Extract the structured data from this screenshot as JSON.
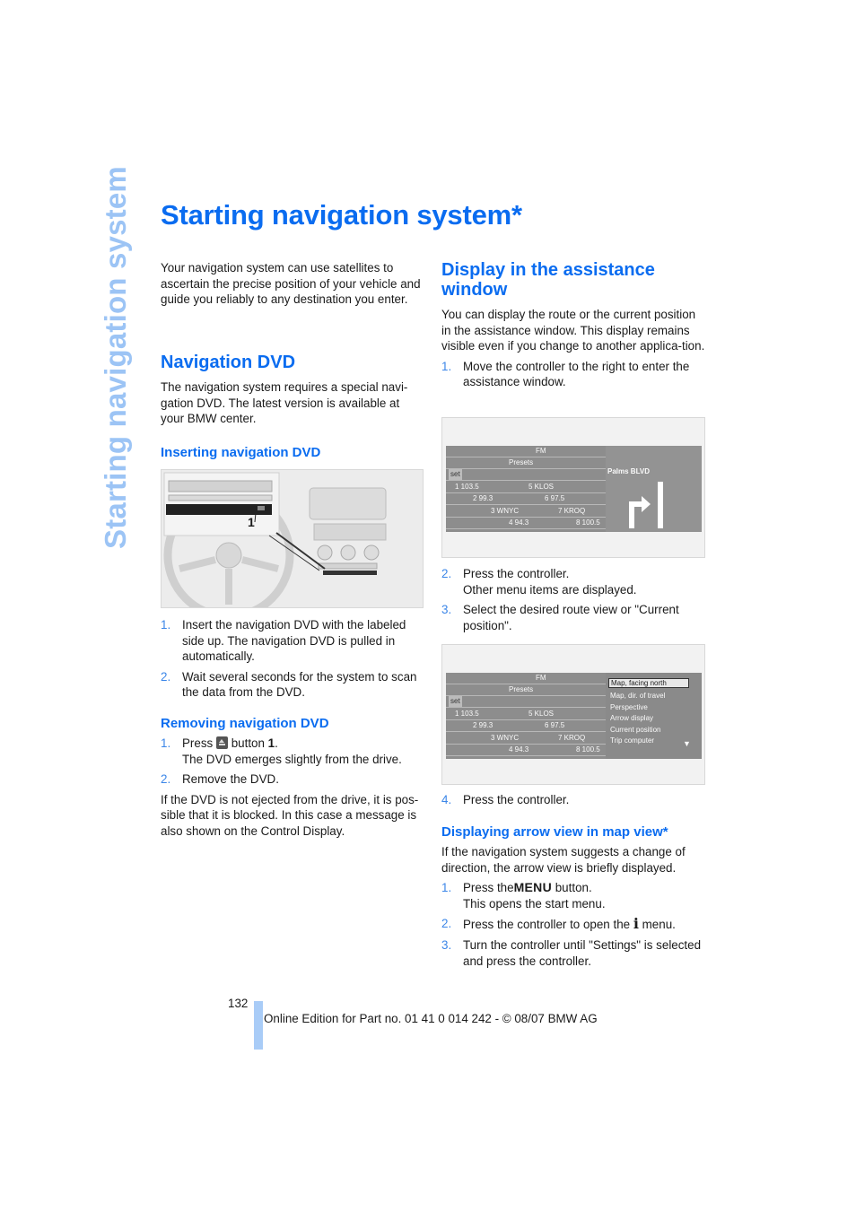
{
  "sidebar": {
    "title": "Starting navigation system"
  },
  "page": {
    "title": "Starting navigation system*"
  },
  "left": {
    "intro": "Your navigation system can use satellites to ascertain the precise position of your vehicle and guide you reliably to any destination you enter.",
    "nav_dvd": {
      "heading": "Navigation DVD",
      "text": "The navigation system requires a special navi-gation DVD. The latest version is available at your BMW center."
    },
    "inserting": {
      "heading": "Inserting navigation DVD",
      "figure_callout": "1",
      "steps": [
        {
          "num": "1.",
          "text": "Insert the navigation DVD with the labeled side up. The navigation DVD is pulled in automatically."
        },
        {
          "num": "2.",
          "text": "Wait several seconds for the system to scan the data from the DVD."
        }
      ]
    },
    "removing": {
      "heading": "Removing navigation DVD",
      "step1_num": "1.",
      "step1_pre": "Press",
      "step1_post": "button",
      "step1_ref": "1",
      "step1_dot": ".",
      "step1_line2": "The DVD emerges slightly from the drive.",
      "step2_num": "2.",
      "step2_text": "Remove the DVD.",
      "note": "If the DVD is not ejected from the drive, it is pos-sible that it is blocked. In this case a message is also shown on the Control Display."
    }
  },
  "right": {
    "assist": {
      "heading": "Display in the assistance window",
      "text": "You can display the route or the current position in the assistance window. This display remains visible even if you change to another applica-tion.",
      "step1": {
        "num": "1.",
        "text": "Move the controller to the right to enter the assistance window."
      },
      "step2": {
        "num": "2.",
        "text": "Press the controller.",
        "line2": "Other menu items are displayed."
      },
      "step3": {
        "num": "3.",
        "text": "Select the desired route view or \"Current position\"."
      },
      "step4": {
        "num": "4.",
        "text": "Press the controller."
      }
    },
    "screen": {
      "band": "FM",
      "presets": "Presets",
      "set": "set",
      "stations": [
        [
          "1 103.5",
          "5 KLOS"
        ],
        [
          "2 99.3",
          "6 97.5"
        ],
        [
          "3 WNYC",
          "7 KROQ"
        ],
        [
          "4 94.3",
          "8 100.5"
        ]
      ],
      "street": "Palms BLVD",
      "menu_items": [
        "Map, facing north",
        "Map, dir. of travel",
        "Perspective",
        "Arrow display",
        "Current position",
        "Trip computer"
      ]
    },
    "arrow": {
      "heading": "Displaying arrow view in map view*",
      "text": "If the navigation system suggests a change of direction, the arrow view is briefly displayed.",
      "step1_num": "1.",
      "step1_pre": "Press the",
      "step1_button": "MENU",
      "step1_post": "button.",
      "step1_line2": "This opens the start menu.",
      "step2_num": "2.",
      "step2_pre": "Press the controller to open the",
      "step2_icon": "i",
      "step2_post": "menu.",
      "step3_num": "3.",
      "step3_text": "Turn the controller until \"Settings\" is selected and press the controller."
    }
  },
  "footer": {
    "page_number": "132",
    "edition": "Online Edition for Part no. 01 41 0 014 242 - © 08/07 BMW AG"
  }
}
